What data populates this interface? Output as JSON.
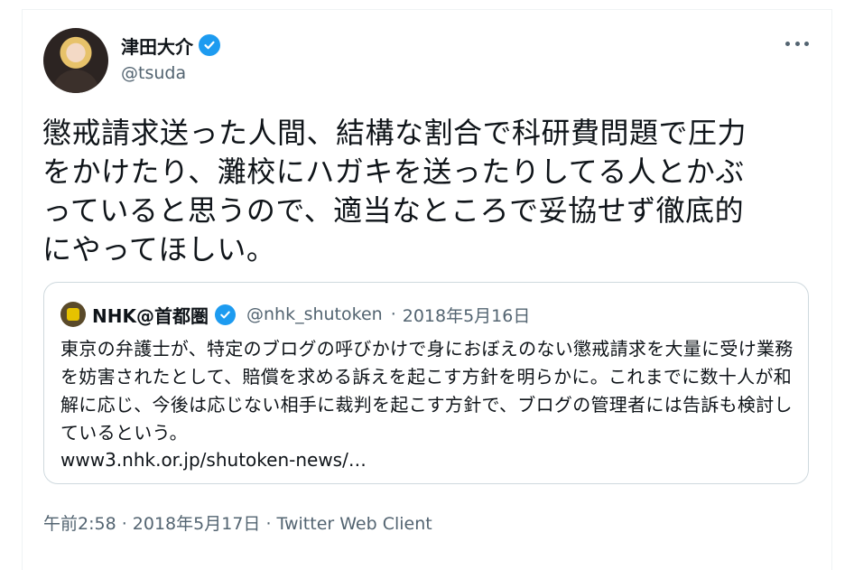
{
  "author": {
    "name": "津田大介",
    "handle": "@tsuda"
  },
  "tweet_text": "懲戒請求送った人間、結構な割合で科研費問題で圧力\nをかけたり、灘校にハガキを送ったりしてる人とかぶ\nっていると思うので、適当なところで妥協せず徹底的\nにやってほしい。",
  "quoted_tweet": {
    "name": "NHK@首都圏",
    "handle": "@nhk_shutoken",
    "date": "2018年5月16日",
    "meta_separator": "·",
    "text": "東京の弁護士が、特定のブログの呼びかけで身におぼえのない懲戒請求を大量に受け業務を妨害されたとして、賠償を求める訴えを起こす方針を明らかに。これまでに数十人が和解に応じ、今後は応じない相手に裁判を起こす方針で、ブログの管理者には告訴も検討しているという。",
    "link": "www3.nhk.or.jp/shutoken-news/…"
  },
  "footer": "午前2:58 · 2018年5月17日 · Twitter Web Client",
  "icons": [
    "verified-icon",
    "more-icon"
  ],
  "colors": {
    "accent": "#1d9bf0",
    "secondary_text": "#536471",
    "border": "#cfd9de"
  }
}
